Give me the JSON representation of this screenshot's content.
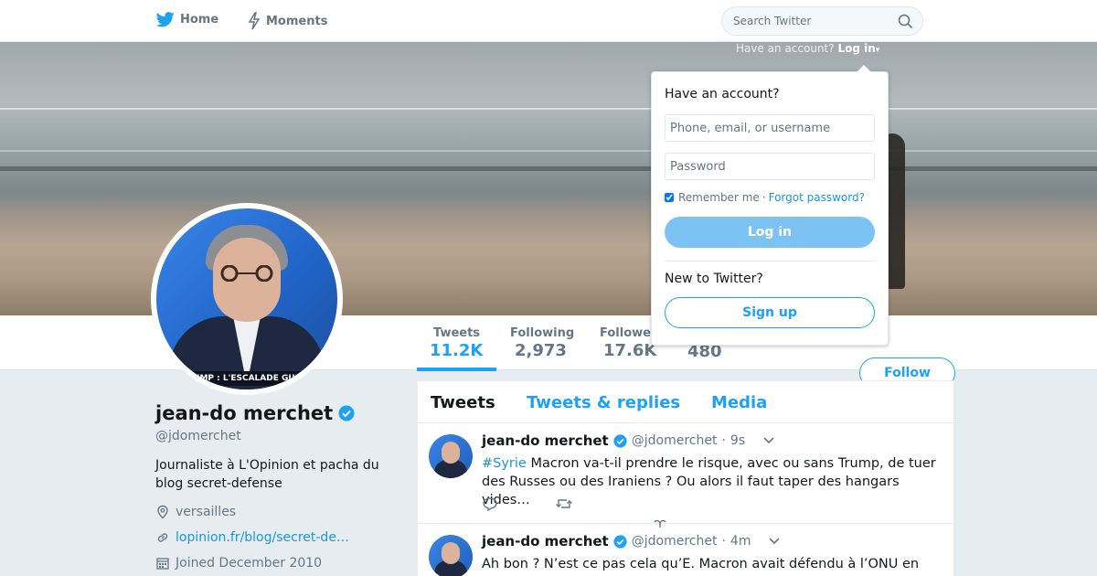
{
  "nav": {
    "home_label": "Home",
    "moments_label": "Moments",
    "search_placeholder": "Search Twitter"
  },
  "login_hint": {
    "prompt": "Have an account?",
    "link": "Log in"
  },
  "login_dropdown": {
    "title": "Have an account?",
    "username_placeholder": "Phone, email, or username",
    "password_placeholder": "Password",
    "remember_label": "Remember me",
    "separator": "·",
    "forgot_label": "Forgot password?",
    "login_button": "Log in",
    "new_label": "New to Twitter?",
    "signup_button": "Sign up"
  },
  "profile": {
    "name": "jean-do merchet",
    "handle": "@jdomerchet",
    "bio": "Journaliste à L'Opinion et pacha du blog secret-defense",
    "location": "versailles",
    "url": "lopinion.fr/blog/secret-de…",
    "joined": "Joined December 2010",
    "avatar_caption": "UMP : L'ESCALADE GUE",
    "verified": true
  },
  "stats": [
    {
      "label": "Tweets",
      "value": "11.2K"
    },
    {
      "label": "Following",
      "value": "2,973"
    },
    {
      "label": "Followers",
      "value": "17.6K"
    },
    {
      "label": "",
      "value": "480"
    }
  ],
  "follow_button": "Follow",
  "timeline": {
    "tabs": [
      "Tweets",
      "Tweets & replies",
      "Media"
    ],
    "tweets": [
      {
        "name": "jean-do merchet",
        "handle": "@jdomerchet",
        "dot": "·",
        "time": "9s",
        "hashtag": "#Syrie",
        "text": "Macron va-t-il prendre le risque, avec ou sans Trump, de tuer des Russes ou des Iraniens ? Ou alors il faut taper des hangars vides…"
      },
      {
        "name": "jean-do merchet",
        "handle": "@jdomerchet",
        "dot": "·",
        "time": "4m",
        "text": "Ah bon ? N’est ce pas cela qu’E. Macron avait défendu à l’ONU en sept. dernier ? Et quelle est l’alternative ?"
      }
    ]
  },
  "colors": {
    "brand_blue": "#1da1f2",
    "link_blue": "#1b95e0",
    "page_bg": "#e6ecf0",
    "muted": "#657786"
  },
  "icons": [
    "twitter-bird-icon",
    "lightning-icon",
    "search-icon",
    "verified-badge-icon",
    "location-pin-icon",
    "link-icon",
    "calendar-icon",
    "reply-icon",
    "retweet-icon",
    "like-icon",
    "chevron-down-icon"
  ]
}
